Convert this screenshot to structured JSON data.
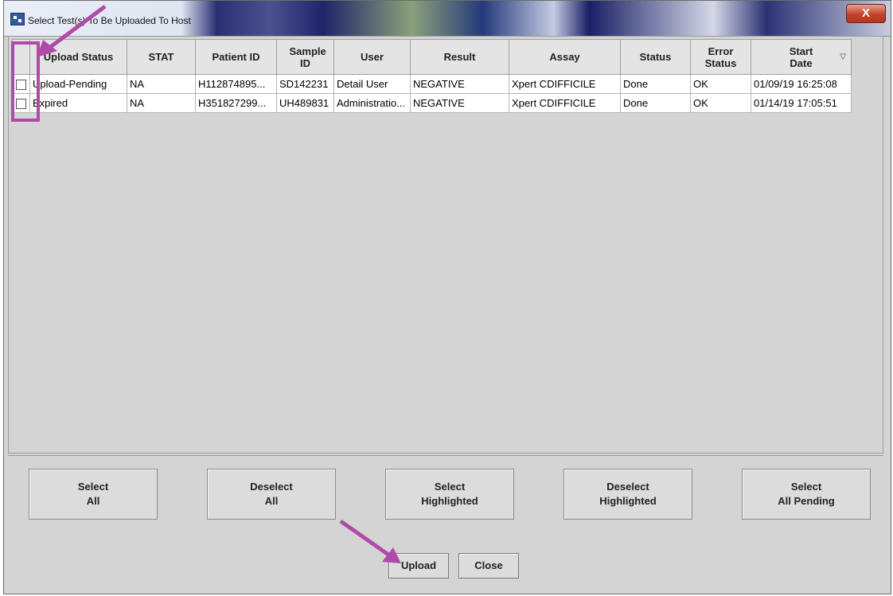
{
  "window": {
    "title": "Select Test(s) To Be Uploaded To Host",
    "close_label": "X"
  },
  "table": {
    "columns": [
      {
        "key": "checkbox",
        "label": ""
      },
      {
        "key": "upload_status",
        "label": "Upload Status"
      },
      {
        "key": "stat",
        "label": "STAT"
      },
      {
        "key": "patient_id",
        "label": "Patient ID"
      },
      {
        "key": "sample_id",
        "label": "Sample ID"
      },
      {
        "key": "user",
        "label": "User"
      },
      {
        "key": "result",
        "label": "Result"
      },
      {
        "key": "assay",
        "label": "Assay"
      },
      {
        "key": "status",
        "label": "Status"
      },
      {
        "key": "error_status",
        "label": "Error Status"
      },
      {
        "key": "start_date",
        "label": "Start Date"
      }
    ],
    "sort_icon": "sort-descending-icon",
    "rows": [
      {
        "checked": false,
        "upload_status": "Upload-Pending",
        "stat": "NA",
        "patient_id": "H112874895...",
        "sample_id": "SD142231",
        "user": "Detail User",
        "result": "NEGATIVE",
        "assay": "Xpert CDIFFICILE",
        "status": "Done",
        "error_status": "OK",
        "start_date": "01/09/19 16:25:08"
      },
      {
        "checked": false,
        "upload_status": "Expired",
        "stat": "NA",
        "patient_id": "H351827299...",
        "sample_id": "UH489831",
        "user": "Administratio...",
        "result": "NEGATIVE",
        "assay": "Xpert CDIFFICILE",
        "status": "Done",
        "error_status": "OK",
        "start_date": "01/14/19 17:05:51"
      }
    ]
  },
  "buttons": {
    "select_all": [
      "Select",
      "All"
    ],
    "deselect_all": [
      "Deselect",
      "All"
    ],
    "select_highlighted": [
      "Select",
      "Highlighted"
    ],
    "deselect_highlighted": [
      "Deselect",
      "Highlighted"
    ],
    "select_all_pending": [
      "Select",
      "All Pending"
    ],
    "upload": "Upload",
    "close": "Close"
  },
  "annotation_color": "#b04aa8"
}
